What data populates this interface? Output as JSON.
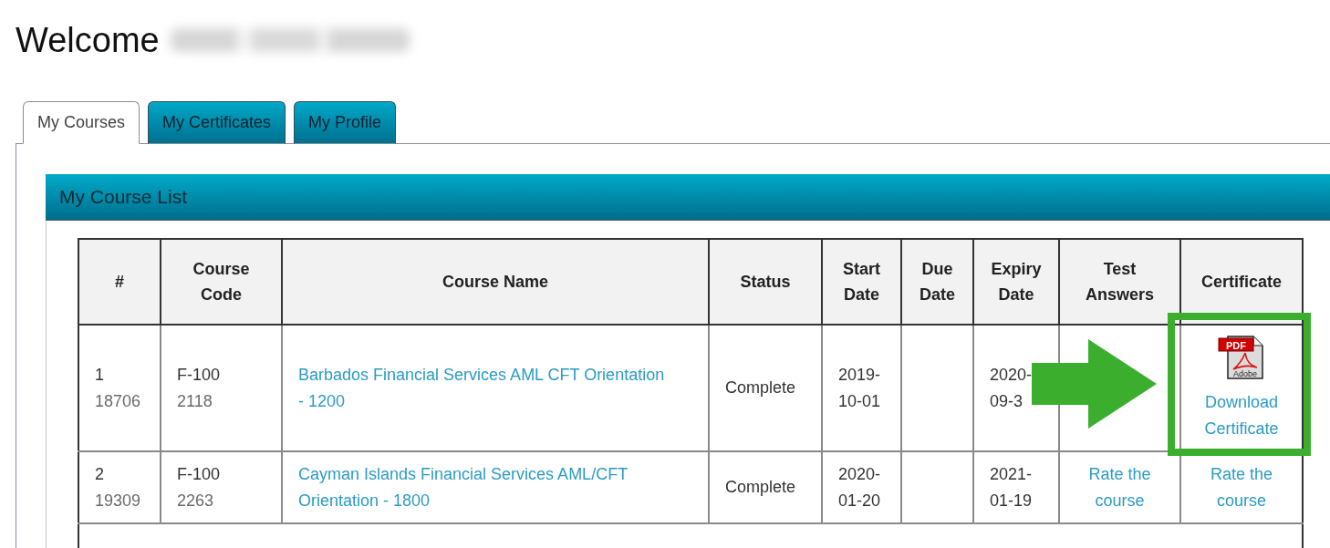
{
  "header": {
    "greeting": "Welcome"
  },
  "tabs": [
    {
      "label": "My Courses",
      "selected": true
    },
    {
      "label": "My Certificates",
      "selected": false
    },
    {
      "label": "My Profile",
      "selected": false
    }
  ],
  "course_list": {
    "title": "My Course List",
    "columns": [
      "#",
      "Course Code",
      "Course Name",
      "Status",
      "Start Date",
      "Due Date",
      "Expiry Date",
      "Test Answers",
      "Certificate"
    ],
    "rows": [
      {
        "number": "1",
        "number_detail": "18706",
        "course_code": "F-100",
        "course_code_detail": "2118",
        "course_name": "Barbados Financial Services AML CFT Orientation - 1200",
        "status": "Complete",
        "start_date": "2019-10-01",
        "expiry_date": "2020-09-3",
        "certificate": {
          "kind": "download",
          "icon_badge": "PDF",
          "icon_caption": "Adobe",
          "label": "Download Certificate"
        }
      },
      {
        "number": "2",
        "number_detail": "19309",
        "course_code": "F-100",
        "course_code_detail": "2263",
        "course_name": "Cayman Islands Financial Services AML/CFT Orientation - 1800",
        "status": "Complete",
        "start_date": "2020-01-20",
        "expiry_date": "2021-01-19",
        "test_answers": "Rate the course",
        "certificate": {
          "kind": "link",
          "label": "Rate the course"
        }
      }
    ]
  }
}
